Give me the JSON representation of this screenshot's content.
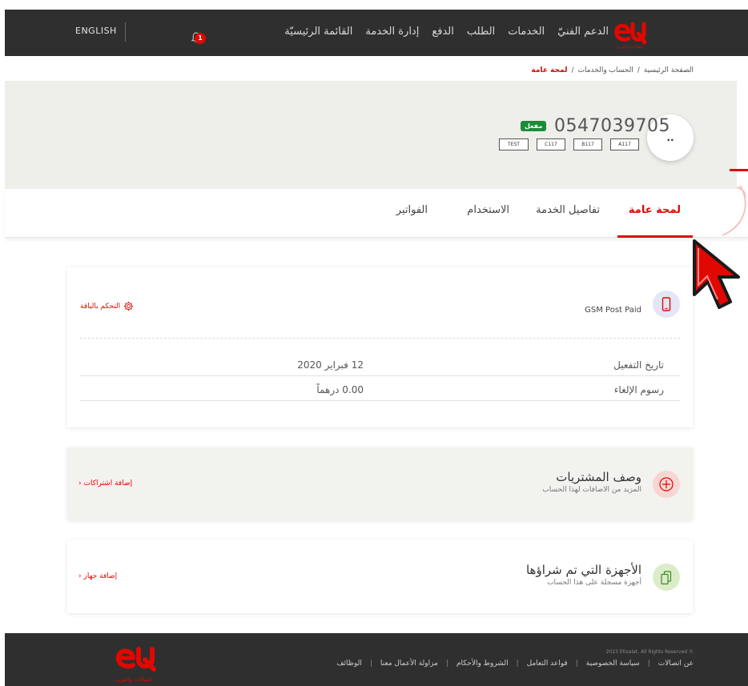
{
  "header": {
    "language_label": "ENGLISH",
    "notification_count": "1",
    "nav_items": [
      "القائمة الرئيسيّة",
      "إدارة الخدمة",
      "الدفع",
      "الطلب",
      "الخدمات",
      "الدعم الفنيّ"
    ],
    "logo_subtitle": "اتصالات والمزيد",
    "brand_color": "#e00800"
  },
  "breadcrumb": {
    "items": [
      "الصفحة الرئيسية",
      "الحساب والخدمات"
    ],
    "current": "لمحة عامة"
  },
  "account": {
    "avatar_text": "..",
    "phone_number": "0547039705",
    "status": "مفعل",
    "status_color": "#1a8c38",
    "tags": [
      "TEST",
      "C117",
      "B117",
      "A117"
    ]
  },
  "tabs": {
    "items": [
      "لمحة عامة",
      "تفاصيل الخدمة",
      "الاستخدام",
      "الفواتير"
    ],
    "active_index": 0
  },
  "plan_card": {
    "title": "GSM Post Paid",
    "control_label": "التحكم بالباقة",
    "rows": [
      {
        "label": "تاريخ التفعيل",
        "value": "12 فبراير 2020"
      },
      {
        "label": "رسوم الإلغاء",
        "value": "0.00 درهماً"
      }
    ]
  },
  "addons_card": {
    "title": "وصف المشتريات",
    "subtitle": "المزيد من الاضافات لهذا الحساب",
    "link_label": "إضافة اشتراكات"
  },
  "devices_card": {
    "title": "الأجهزة التي تم شراؤها",
    "subtitle": "أجهزة مسجلة على هذا الحساب",
    "link_label": "إضافة جهاز"
  },
  "footer": {
    "copyright": "2023 Etisalat. All Rights Reserved ©",
    "links": [
      "عن اتصالات",
      "سياسة الخصوصية",
      "قواعد التعامل",
      "الشروط والأحكام",
      "مزاولة الأعمال معنا",
      "الوظائف"
    ],
    "logo_subtitle": "اتصالات والمزيد"
  }
}
